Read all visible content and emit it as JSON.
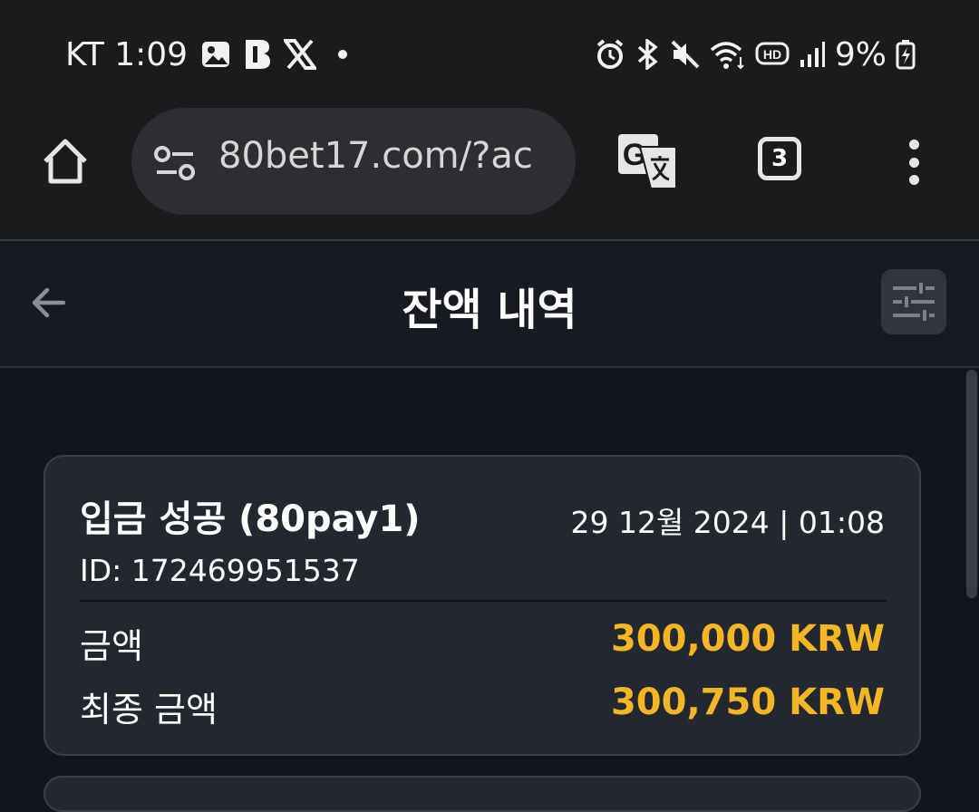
{
  "status_bar": {
    "carrier_time": "KT 1:09",
    "battery": "9%",
    "icons": [
      "gallery-icon",
      "b-app-icon",
      "x-app-icon",
      "dot-icon",
      "alarm-icon",
      "bluetooth-icon",
      "mute-icon",
      "wifi-icon",
      "hd-icon",
      "signal-icon",
      "battery-charging-icon"
    ]
  },
  "browser": {
    "url": "80bet17.com/?ac",
    "tab_count": "3",
    "icons": [
      "home-icon",
      "site-settings-icon",
      "translate-icon",
      "tabs-icon",
      "more-menu-icon"
    ]
  },
  "page": {
    "title": "잔액 내역",
    "icons": [
      "back-arrow-icon",
      "filter-sliders-icon"
    ]
  },
  "transactions": [
    {
      "title": "입금 성공 (80pay1)",
      "datetime": "29 12월 2024 | 01:08",
      "id": "ID: 172469951537",
      "amount_label": "금액",
      "amount_value": "300,000 KRW",
      "final_label": "최종 금액",
      "final_value": "300,750 KRW"
    }
  ],
  "colors": {
    "background": "#12151b",
    "card": "#232830",
    "accent_amount": "#f5b626",
    "browser_bar": "#1b1b1d"
  }
}
